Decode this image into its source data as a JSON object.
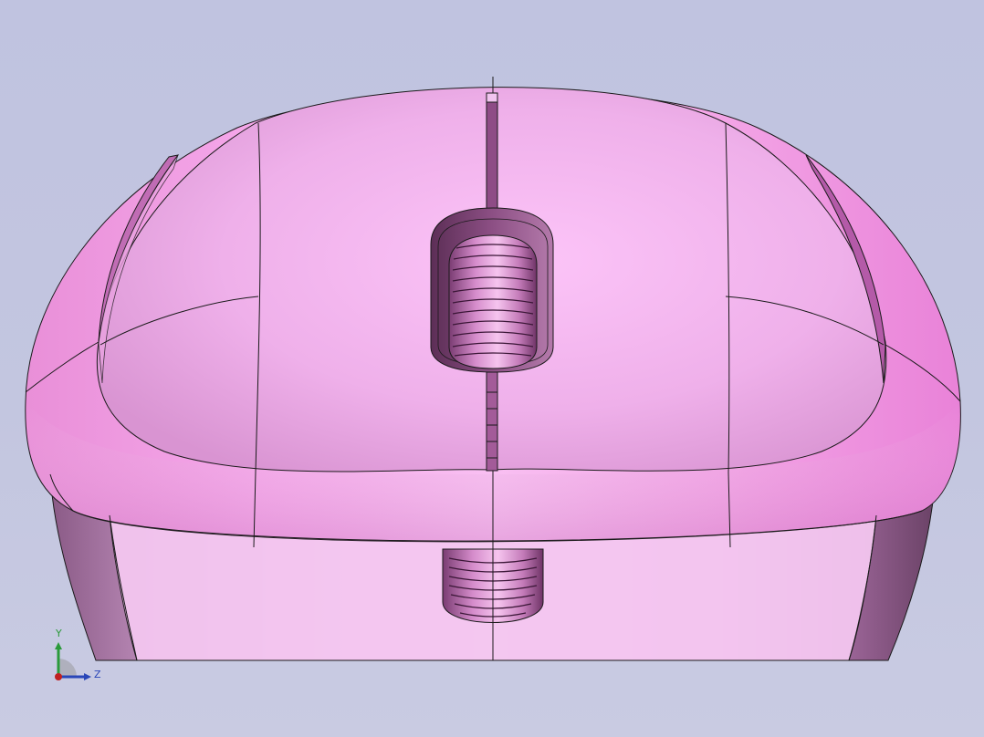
{
  "viewport": {
    "background_top": "#c0c3e0",
    "background_bottom": "#c9cbe2",
    "model_name": "computer-mouse",
    "model_color_base": "#f7b6f0",
    "model_color_shadow": "#c07ab8",
    "edge_color": "#1a1a1a"
  },
  "triad": {
    "y_label": "Y",
    "z_label": "Z",
    "y_color": "#2a9a3a",
    "z_color": "#2a46b8",
    "origin_color": "#c02020"
  }
}
